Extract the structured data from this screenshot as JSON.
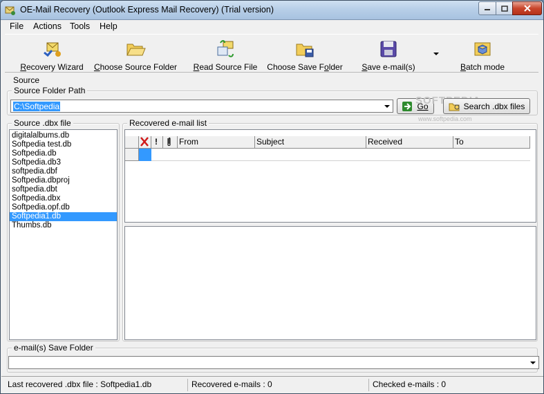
{
  "window": {
    "title": "OE-Mail Recovery (Outlook Express Mail Recovery) (Trial version)"
  },
  "menu": [
    "File",
    "Actions",
    "Tools",
    "Help"
  ],
  "toolbar": {
    "recovery_wizard": "Recovery Wizard",
    "choose_source_folder": "Choose Source Folder",
    "read_source_file": "Read Source File",
    "choose_save_folder": "Choose Save Folder",
    "save_emails": "Save e-mail(s)",
    "batch_mode": "Batch mode"
  },
  "source": {
    "section_label": "Source",
    "folder_path_label": "Source Folder Path",
    "folder_path_value": "C:\\Softpedia",
    "go_label": "Go",
    "search_label": "Search .dbx files"
  },
  "watermark": {
    "brand": "SOFTPEDIA",
    "url": "www.softpedia.com"
  },
  "dbx_panel": {
    "label": "Source .dbx file",
    "files": [
      "digitalalbums.db",
      "Softpedia test.db",
      "Softpedia.db",
      "Softpedia.db3",
      "softpedia.dbf",
      "Softpedia.dbproj",
      "softpedia.dbt",
      "Softpedia.dbx",
      "Softpedia.opf.db",
      "Softpedia1.db",
      "Thumbs.db"
    ],
    "selected_file": "Softpedia1.db"
  },
  "email_list": {
    "label": "Recovered e-mail list",
    "columns": {
      "priority": "!",
      "from": "From",
      "subject": "Subject",
      "received": "Received",
      "to": "To"
    }
  },
  "save_folder": {
    "label": "e-mail(s) Save Folder",
    "value": ""
  },
  "status": {
    "last_recovered": "Last recovered .dbx file : Softpedia1.db",
    "recovered_count": "Recovered e-mails : 0",
    "checked_count": "Checked e-mails : 0"
  },
  "colors": {
    "selection": "#3399ff",
    "close_button": "#c9462c",
    "title_bar": "#b8cfe8"
  }
}
